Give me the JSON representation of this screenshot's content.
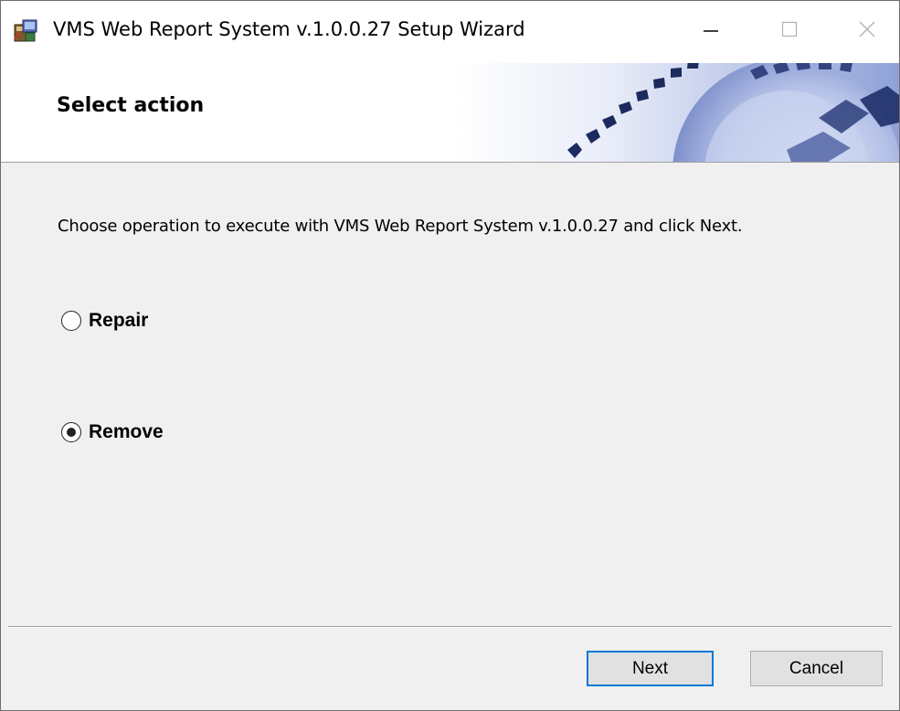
{
  "window": {
    "title": "VMS Web Report System v.1.0.0.27 Setup Wizard",
    "controls": [
      "minimize-icon",
      "maximize-icon",
      "close-icon"
    ]
  },
  "banner": {
    "title": "Select action"
  },
  "content": {
    "instruction": "Choose operation to execute with VMS Web Report System v.1.0.0.27 and click Next.",
    "options": [
      {
        "label": "Repair",
        "selected": false
      },
      {
        "label": "Remove",
        "selected": true
      }
    ]
  },
  "footer": {
    "next_label": "Next",
    "cancel_label": "Cancel"
  },
  "colors": {
    "focus_border": "#0078d7",
    "dialog_background": "#f0f0f0"
  }
}
